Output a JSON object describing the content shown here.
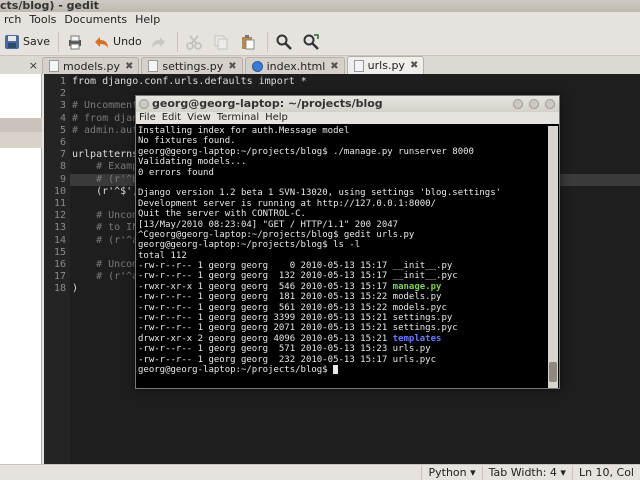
{
  "gedit": {
    "title": "cts/blog) - gedit",
    "menu": [
      "rch",
      "Tools",
      "Documents",
      "Help"
    ],
    "toolbar": {
      "save": "Save",
      "undo": "Undo"
    },
    "sidebar_header": "×",
    "tabs": [
      {
        "label": "models.py",
        "active": false
      },
      {
        "label": "settings.py",
        "active": false
      },
      {
        "label": "index.html",
        "active": false
      },
      {
        "label": "urls.py",
        "active": true
      }
    ],
    "line_numbers": [
      "1",
      "2",
      "3",
      "4",
      "5",
      "6",
      "7",
      "8",
      "9",
      "10",
      "11",
      "12",
      "13",
      "14",
      "15",
      "16",
      "17",
      "18"
    ],
    "code_lines": [
      {
        "text": "from django.conf.urls.defaults import *",
        "comment": false
      },
      {
        "text": "",
        "comment": false
      },
      {
        "text": "# Uncomment t",
        "comment": true
      },
      {
        "text": "# from django",
        "comment": true
      },
      {
        "text": "# admin.autod",
        "comment": true
      },
      {
        "text": "",
        "comment": false
      },
      {
        "text": "urlpatterns =",
        "comment": false
      },
      {
        "text": "    # Example",
        "comment": true
      },
      {
        "text": "    # (r'^blo",
        "comment": true
      },
      {
        "text": "    (r'^$', ",
        "comment": false
      },
      {
        "text": "",
        "comment": false
      },
      {
        "text": "    # Uncomme",
        "comment": true
      },
      {
        "text": "    # to INST",
        "comment": true
      },
      {
        "text": "    # (r'^adm",
        "comment": true
      },
      {
        "text": "",
        "comment": false
      },
      {
        "text": "    # Uncomme",
        "comment": true
      },
      {
        "text": "    # (r'^adm",
        "comment": true
      },
      {
        "text": ")",
        "comment": false
      }
    ],
    "status": {
      "language": "Python ▾",
      "tab_width": "Tab Width: 4 ▾",
      "position": "Ln 10, Col"
    }
  },
  "terminal": {
    "title": "georg@georg-laptop: ~/projects/blog",
    "menu": [
      "File",
      "Edit",
      "View",
      "Terminal",
      "Help"
    ],
    "lines": [
      {
        "t": "Installing index for auth.Message model"
      },
      {
        "t": "No fixtures found."
      },
      {
        "t": "georg@georg-laptop:~/projects/blog$ ./manage.py runserver 8000"
      },
      {
        "t": "Validating models..."
      },
      {
        "t": "0 errors found"
      },
      {
        "t": ""
      },
      {
        "t": "Django version 1.2 beta 1 SVN-13020, using settings 'blog.settings'"
      },
      {
        "t": "Development server is running at http://127.0.0.1:8000/"
      },
      {
        "t": "Quit the server with CONTROL-C."
      },
      {
        "t": "[13/May/2010 08:23:04] \"GET / HTTP/1.1\" 200 2047"
      },
      {
        "t": "^Cgeorg@georg-laptop:~/projects/blog$ gedit urls.py"
      },
      {
        "t": "georg@georg-laptop:~/projects/blog$ ls -l"
      },
      {
        "t": "total 112"
      },
      {
        "t": "-rw-r--r-- 1 georg georg    0 2010-05-13 15:17 ",
        "f": "__init__.py"
      },
      {
        "t": "-rw-r--r-- 1 georg georg  132 2010-05-13 15:17 ",
        "f": "__init__.pyc"
      },
      {
        "t": "-rwxr-xr-x 1 georg georg  546 2010-05-13 15:17 ",
        "f": "manage.py",
        "c": "green"
      },
      {
        "t": "-rw-r--r-- 1 georg georg  181 2010-05-13 15:22 ",
        "f": "models.py"
      },
      {
        "t": "-rw-r--r-- 1 georg georg  561 2010-05-13 15:22 ",
        "f": "models.pyc"
      },
      {
        "t": "-rw-r--r-- 1 georg georg 3399 2010-05-13 15:21 ",
        "f": "settings.py"
      },
      {
        "t": "-rw-r--r-- 1 georg georg 2071 2010-05-13 15:21 ",
        "f": "settings.pyc"
      },
      {
        "t": "drwxr-xr-x 2 georg georg 4096 2010-05-13 15:21 ",
        "f": "templates",
        "c": "blue"
      },
      {
        "t": "-rw-r--r-- 1 georg georg  571 2010-05-13 15:23 ",
        "f": "urls.py"
      },
      {
        "t": "-rw-r--r-- 1 georg georg  232 2010-05-13 15:17 ",
        "f": "urls.pyc"
      },
      {
        "t": "georg@georg-laptop:~/projects/blog$ ",
        "cursor": true
      }
    ]
  }
}
